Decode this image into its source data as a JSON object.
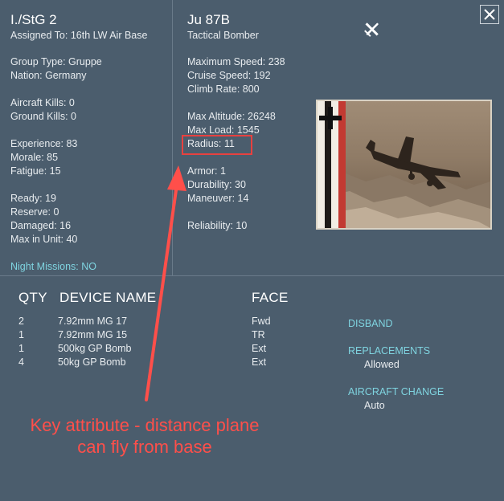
{
  "unit": {
    "name": "I./StG 2",
    "assigned_to": "Assigned To: 16th LW Air Base",
    "group_type": "Group Type: Gruppe",
    "nation": "Nation: Germany",
    "aircraft_kills": "Aircraft Kills: 0",
    "ground_kills": "Ground Kills: 0",
    "experience": "Experience: 83",
    "morale": "Morale: 85",
    "fatigue": "Fatigue: 15",
    "ready": "Ready: 19",
    "reserve": "Reserve: 0",
    "damaged": "Damaged: 16",
    "max_in_unit": "Max in Unit:  40",
    "night_missions": "Night Missions: NO"
  },
  "aircraft": {
    "name": "Ju 87B",
    "role": "Tactical Bomber",
    "max_speed": "Maximum Speed: 238",
    "cruise_speed": "Cruise Speed: 192",
    "climb_rate": "Climb Rate: 800",
    "max_altitude": "Max Altitude: 26248",
    "max_load": "Max Load: 1545",
    "radius": "Radius: 11",
    "armor": "Armor: 1",
    "durability": "Durability: 30",
    "maneuver": "Maneuver: 14",
    "reliability": "Reliability: 10"
  },
  "devices": {
    "headers": {
      "qty": "QTY",
      "name": "DEVICE NAME",
      "face": "FACE"
    },
    "rows": [
      {
        "qty": "2",
        "name": "7.92mm MG 17",
        "face": "Fwd"
      },
      {
        "qty": "1",
        "name": "7.92mm MG 15",
        "face": "TR"
      },
      {
        "qty": "1",
        "name": "500kg GP Bomb",
        "face": "Ext"
      },
      {
        "qty": "4",
        "name": "50kg GP Bomb",
        "face": "Ext"
      }
    ]
  },
  "actions": {
    "disband": "DISBAND",
    "replacements": "REPLACEMENTS",
    "replacements_value": "Allowed",
    "aircraft_change": "AIRCRAFT CHANGE",
    "aircraft_change_value": "Auto"
  },
  "annotation": {
    "text": "Key attribute - distance plane can fly from base",
    "color": "#ff4f4a"
  },
  "icons": {
    "close": "close-icon",
    "plane": "airplane-icon"
  },
  "colors": {
    "background": "#4b5d6d",
    "accent": "#7fd4e0",
    "highlight": "#e8413f"
  }
}
